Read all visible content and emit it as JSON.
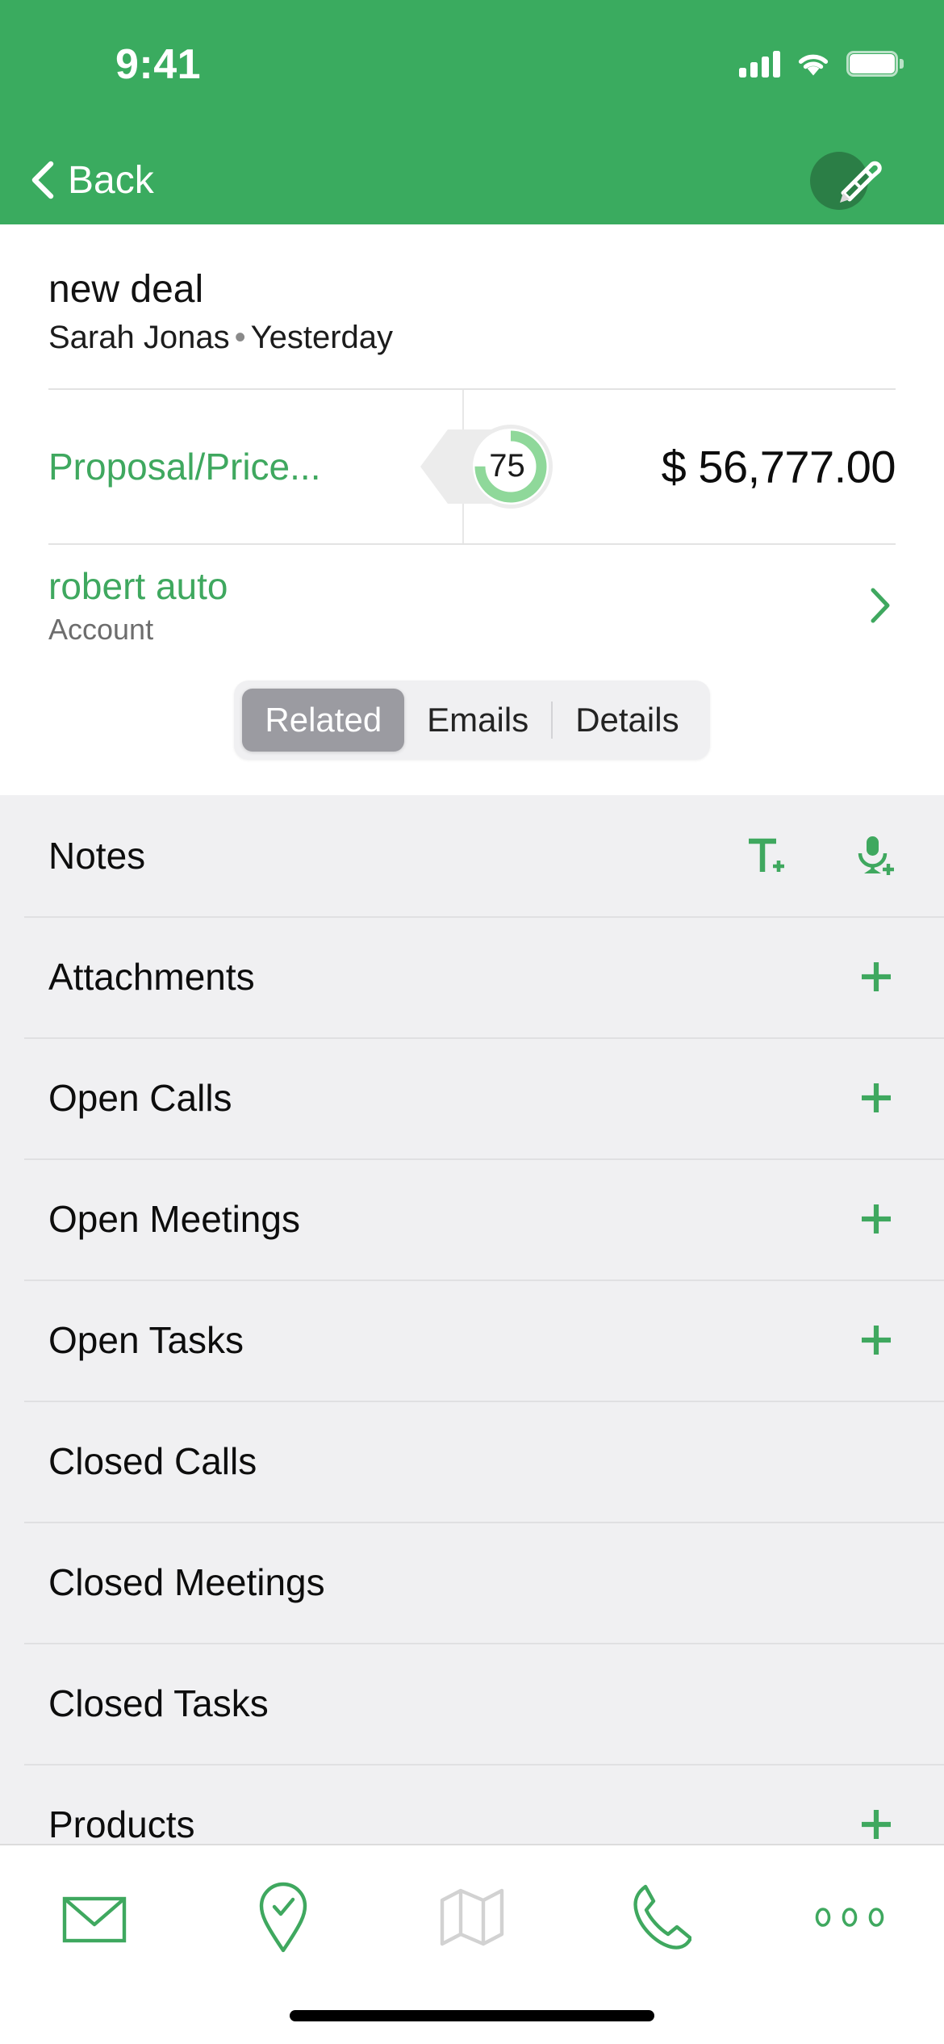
{
  "status_bar": {
    "time": "9:41",
    "icons": [
      "cellular-signal-icon",
      "wifi-icon",
      "battery-icon"
    ],
    "background_color": "#3aab5f"
  },
  "nav_bar": {
    "back_label": "Back",
    "back_icon": "chevron-left-icon",
    "edit_icon": "pencil-edit-icon",
    "background_color": "#3aab5f"
  },
  "record": {
    "title": "new deal",
    "owner": "Sarah Jonas",
    "separator": "•",
    "modified": "Yesterday",
    "stage": "Proposal/Price...",
    "probability": "75",
    "amount": "$ 56,777.00",
    "account_name": "robert auto",
    "account_label": "Account",
    "account_chevron_icon": "chevron-right-icon",
    "accent_color": "#3fa85f",
    "gauge_track_color": "#e9e9e9",
    "gauge_progress_color": "#8fd89a"
  },
  "tabs": {
    "items": [
      {
        "label": "Related",
        "selected": true
      },
      {
        "label": "Emails",
        "selected": false
      },
      {
        "label": "Details",
        "selected": false
      }
    ],
    "active_background": "#9b9ba1"
  },
  "related_list": {
    "rows": [
      {
        "label": "Notes",
        "actions": [
          "add-text-note-icon",
          "add-voice-note-icon"
        ]
      },
      {
        "label": "Attachments",
        "actions": [
          "plus-icon"
        ]
      },
      {
        "label": "Open Calls",
        "actions": [
          "plus-icon"
        ]
      },
      {
        "label": "Open Meetings",
        "actions": [
          "plus-icon"
        ]
      },
      {
        "label": "Open Tasks",
        "actions": [
          "plus-icon"
        ]
      },
      {
        "label": "Closed Calls",
        "actions": []
      },
      {
        "label": "Closed Meetings",
        "actions": []
      },
      {
        "label": "Closed Tasks",
        "actions": []
      },
      {
        "label": "Products",
        "actions": [
          "plus-icon"
        ]
      }
    ],
    "background_color": "#f0f0f2"
  },
  "tab_bar": {
    "items": [
      {
        "name": "email-icon",
        "enabled": true
      },
      {
        "name": "check-in-icon",
        "enabled": true
      },
      {
        "name": "map-icon",
        "enabled": false
      },
      {
        "name": "phone-icon",
        "enabled": true
      },
      {
        "name": "more-icon",
        "enabled": true
      }
    ],
    "enabled_color": "#3fa85f",
    "disabled_color": "#d2d2d2"
  }
}
